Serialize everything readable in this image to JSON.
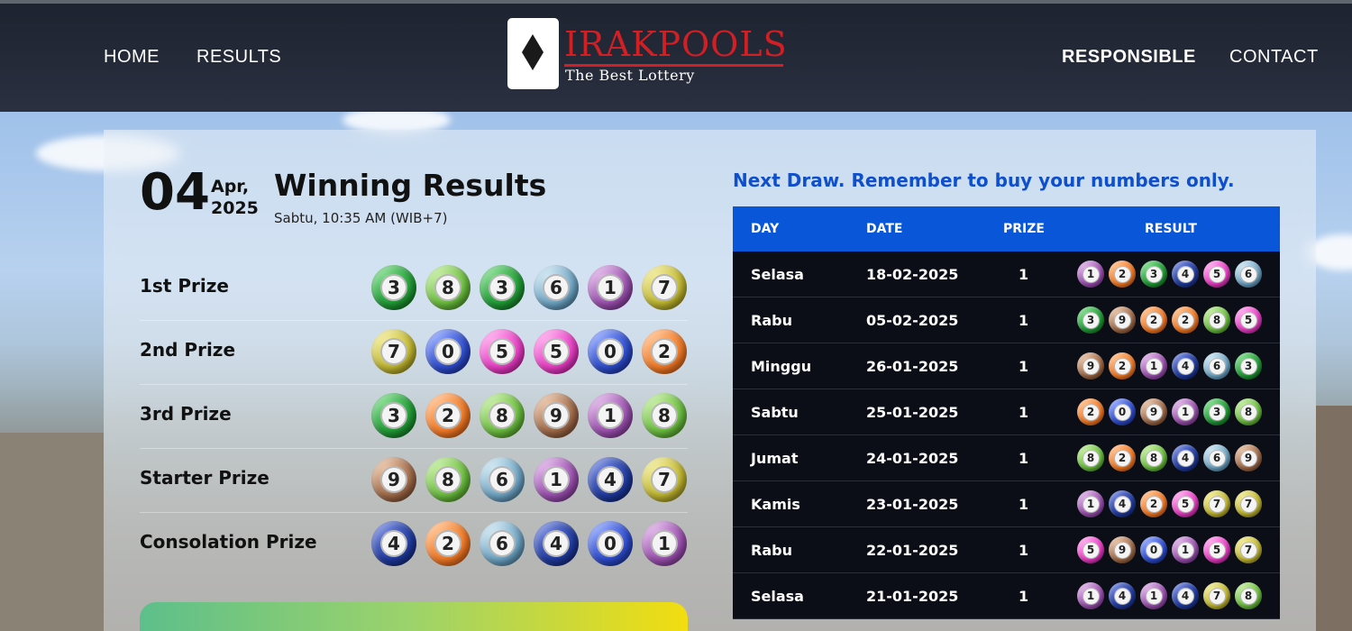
{
  "nav": {
    "home": "HOME",
    "results": "RESULTS",
    "responsible": "RESPONSIBLE",
    "contact": "CONTACT"
  },
  "logo": {
    "title": "IRAKPOOLS",
    "tagline": "The Best Lottery"
  },
  "draw": {
    "day": "04",
    "month": "Apr,",
    "year": "2025",
    "title": "Winning Results",
    "subtitle": "Sabtu, 10:35 AM (WIB+7)"
  },
  "prizes": [
    {
      "label": "1st Prize",
      "balls": [
        {
          "n": "3",
          "c": "green"
        },
        {
          "n": "8",
          "c": "lgreen"
        },
        {
          "n": "3",
          "c": "green"
        },
        {
          "n": "6",
          "c": "teal"
        },
        {
          "n": "1",
          "c": "purple"
        },
        {
          "n": "7",
          "c": "olive"
        }
      ]
    },
    {
      "label": "2nd Prize",
      "balls": [
        {
          "n": "7",
          "c": "olive"
        },
        {
          "n": "0",
          "c": "blue"
        },
        {
          "n": "5",
          "c": "pink"
        },
        {
          "n": "5",
          "c": "pink"
        },
        {
          "n": "0",
          "c": "blue"
        },
        {
          "n": "2",
          "c": "orange"
        }
      ]
    },
    {
      "label": "3rd Prize",
      "balls": [
        {
          "n": "3",
          "c": "green"
        },
        {
          "n": "2",
          "c": "orange"
        },
        {
          "n": "8",
          "c": "lgreen"
        },
        {
          "n": "9",
          "c": "brown"
        },
        {
          "n": "1",
          "c": "purple"
        },
        {
          "n": "8",
          "c": "lgreen"
        }
      ]
    },
    {
      "label": "Starter Prize",
      "balls": [
        {
          "n": "9",
          "c": "brown"
        },
        {
          "n": "8",
          "c": "lgreen"
        },
        {
          "n": "6",
          "c": "teal"
        },
        {
          "n": "1",
          "c": "purple"
        },
        {
          "n": "4",
          "c": "navy"
        },
        {
          "n": "7",
          "c": "olive"
        }
      ]
    },
    {
      "label": "Consolation Prize",
      "balls": [
        {
          "n": "4",
          "c": "navy"
        },
        {
          "n": "2",
          "c": "orange"
        },
        {
          "n": "6",
          "c": "teal"
        },
        {
          "n": "4",
          "c": "navy"
        },
        {
          "n": "0",
          "c": "blue"
        },
        {
          "n": "1",
          "c": "purple"
        }
      ]
    }
  ],
  "next": {
    "title": "Next Draw. Remember to buy your numbers only.",
    "columns": [
      "DAY",
      "DATE",
      "PRIZE",
      "RESULT"
    ],
    "rows": [
      {
        "day": "Selasa",
        "date": "18-02-2025",
        "prize": "1",
        "result": [
          {
            "n": "1",
            "c": "purple"
          },
          {
            "n": "2",
            "c": "orange"
          },
          {
            "n": "3",
            "c": "green"
          },
          {
            "n": "4",
            "c": "navy"
          },
          {
            "n": "5",
            "c": "pink"
          },
          {
            "n": "6",
            "c": "teal"
          }
        ]
      },
      {
        "day": "Rabu",
        "date": "05-02-2025",
        "prize": "1",
        "result": [
          {
            "n": "3",
            "c": "green"
          },
          {
            "n": "9",
            "c": "brown"
          },
          {
            "n": "2",
            "c": "orange"
          },
          {
            "n": "2",
            "c": "orange"
          },
          {
            "n": "8",
            "c": "lgreen"
          },
          {
            "n": "5",
            "c": "pink"
          }
        ]
      },
      {
        "day": "Minggu",
        "date": "26-01-2025",
        "prize": "1",
        "result": [
          {
            "n": "9",
            "c": "brown"
          },
          {
            "n": "2",
            "c": "orange"
          },
          {
            "n": "1",
            "c": "purple"
          },
          {
            "n": "4",
            "c": "navy"
          },
          {
            "n": "6",
            "c": "teal"
          },
          {
            "n": "3",
            "c": "green"
          }
        ]
      },
      {
        "day": "Sabtu",
        "date": "25-01-2025",
        "prize": "1",
        "result": [
          {
            "n": "2",
            "c": "orange"
          },
          {
            "n": "0",
            "c": "blue"
          },
          {
            "n": "9",
            "c": "brown"
          },
          {
            "n": "1",
            "c": "purple"
          },
          {
            "n": "3",
            "c": "green"
          },
          {
            "n": "8",
            "c": "lgreen"
          }
        ]
      },
      {
        "day": "Jumat",
        "date": "24-01-2025",
        "prize": "1",
        "result": [
          {
            "n": "8",
            "c": "lgreen"
          },
          {
            "n": "2",
            "c": "orange"
          },
          {
            "n": "8",
            "c": "lgreen"
          },
          {
            "n": "4",
            "c": "navy"
          },
          {
            "n": "6",
            "c": "teal"
          },
          {
            "n": "9",
            "c": "brown"
          }
        ]
      },
      {
        "day": "Kamis",
        "date": "23-01-2025",
        "prize": "1",
        "result": [
          {
            "n": "1",
            "c": "purple"
          },
          {
            "n": "4",
            "c": "navy"
          },
          {
            "n": "2",
            "c": "orange"
          },
          {
            "n": "5",
            "c": "pink"
          },
          {
            "n": "7",
            "c": "olive"
          },
          {
            "n": "7",
            "c": "olive"
          }
        ]
      },
      {
        "day": "Rabu",
        "date": "22-01-2025",
        "prize": "1",
        "result": [
          {
            "n": "5",
            "c": "pink"
          },
          {
            "n": "9",
            "c": "brown"
          },
          {
            "n": "0",
            "c": "blue"
          },
          {
            "n": "1",
            "c": "purple"
          },
          {
            "n": "5",
            "c": "pink"
          },
          {
            "n": "7",
            "c": "olive"
          }
        ]
      },
      {
        "day": "Selasa",
        "date": "21-01-2025",
        "prize": "1",
        "result": [
          {
            "n": "1",
            "c": "purple"
          },
          {
            "n": "4",
            "c": "navy"
          },
          {
            "n": "1",
            "c": "purple"
          },
          {
            "n": "4",
            "c": "navy"
          },
          {
            "n": "7",
            "c": "olive"
          },
          {
            "n": "8",
            "c": "lgreen"
          }
        ]
      }
    ]
  },
  "colors": {
    "header_bg": "#232837",
    "accent_blue": "#0a56d8",
    "next_title": "#0d4fcc",
    "logo_red": "#d21f24",
    "table_row_bg": "#0b0e16"
  }
}
